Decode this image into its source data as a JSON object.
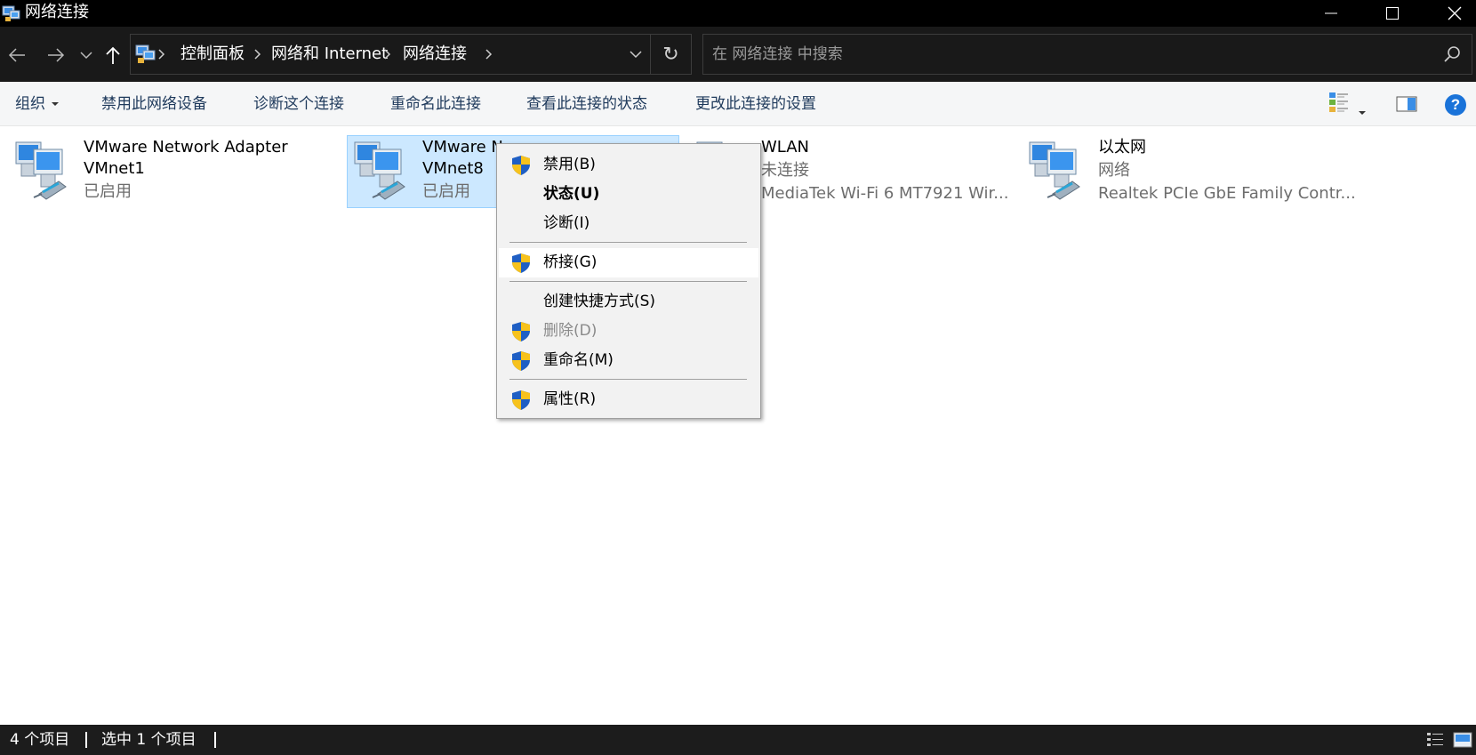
{
  "window": {
    "title": "网络连接",
    "icon": "network-connections-icon"
  },
  "address_bar": {
    "breadcrumbs": [
      "控制面板",
      "网络和 Internet",
      "网络连接"
    ],
    "refresh_icon": "↻",
    "search_placeholder": "在 网络连接 中搜索"
  },
  "toolbar": {
    "organize_label": "组织",
    "commands": [
      "禁用此网络设备",
      "诊断这个连接",
      "重命名此连接",
      "查看此连接的状态",
      "更改此连接的设置"
    ],
    "help_label": "?"
  },
  "items": [
    {
      "name_line1": "VMware Network Adapter",
      "name_line2": "VMnet1",
      "status": "已启用",
      "selected": false
    },
    {
      "name_line1": "VMware N",
      "name_line2": "VMnet8",
      "status": "已启用",
      "selected": true
    },
    {
      "name_line1": "WLAN",
      "status": "未连接",
      "device": "MediaTek Wi-Fi 6 MT7921 Wir...",
      "selected": false
    },
    {
      "name_line1": "以太网",
      "status": "网络",
      "device": "Realtek PCIe GbE Family Contr...",
      "selected": false
    }
  ],
  "context_menu": {
    "items": [
      {
        "label": "禁用(B)",
        "shield": true
      },
      {
        "label": "状态(U)",
        "shield": false,
        "bold": true
      },
      {
        "label": "诊断(I)",
        "shield": false
      },
      {
        "label": "桥接(G)",
        "shield": true,
        "hover": true
      },
      {
        "label": "创建快捷方式(S)",
        "shield": false
      },
      {
        "label": "删除(D)",
        "shield": true,
        "disabled": true
      },
      {
        "label": "重命名(M)",
        "shield": true
      },
      {
        "label": "属性(R)",
        "shield": true
      }
    ]
  },
  "status_bar": {
    "item_count": "4 个项目",
    "selected_count": "选中 1 个项目"
  },
  "colors": {
    "titlebar_bg": "#000000",
    "addressbar_bg": "#191919",
    "selection_bg": "#cce8ff",
    "selection_border": "#99d1ff",
    "command_text": "#1e395b",
    "shield_blue": "#1f5fc4",
    "shield_yellow": "#f7c21c"
  }
}
